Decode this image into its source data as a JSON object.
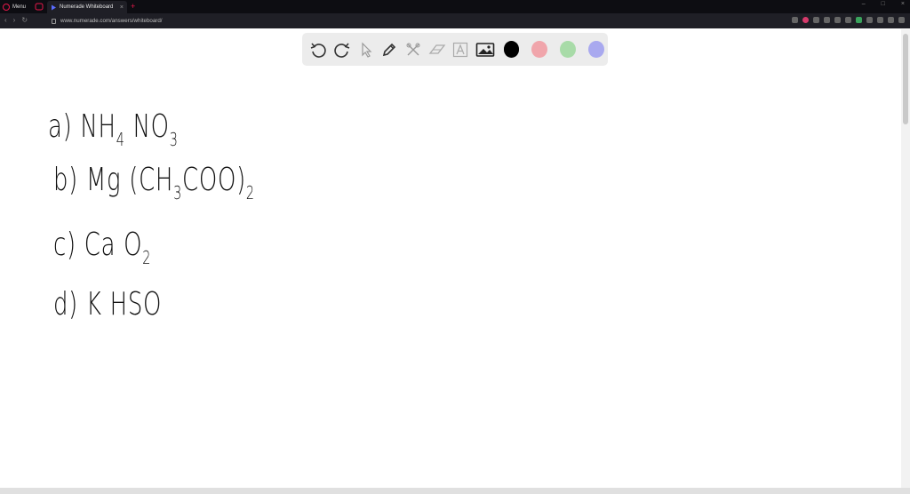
{
  "browser": {
    "menu_label": "Menu",
    "tab_title": "Numerade Whiteboard",
    "url": "www.numerade.com/answers/whiteboard/"
  },
  "toolbar": {
    "tools": [
      "undo-icon",
      "redo-icon",
      "select-icon",
      "pen-icon",
      "tools-icon",
      "eraser-icon",
      "text-icon",
      "image-icon"
    ],
    "colors": [
      "#000000",
      "#f0a5ab",
      "#a8dba8",
      "#a9a9ef"
    ]
  },
  "whiteboard": {
    "lines": [
      {
        "label": "a)",
        "formula_parts": [
          {
            "t": "NH"
          },
          {
            "sub": "4"
          },
          {
            "t": " NO"
          },
          {
            "sub": "3"
          }
        ]
      },
      {
        "label": "b)",
        "formula_parts": [
          {
            "t": "Mg (CH"
          },
          {
            "sub": "3"
          },
          {
            "t": "COO)"
          },
          {
            "sub": "2"
          }
        ]
      },
      {
        "label": "c)",
        "formula_parts": [
          {
            "t": "Ca O"
          },
          {
            "sub": "2"
          }
        ]
      },
      {
        "label": "d)",
        "formula_parts": [
          {
            "t": "K HSO"
          }
        ]
      }
    ]
  }
}
